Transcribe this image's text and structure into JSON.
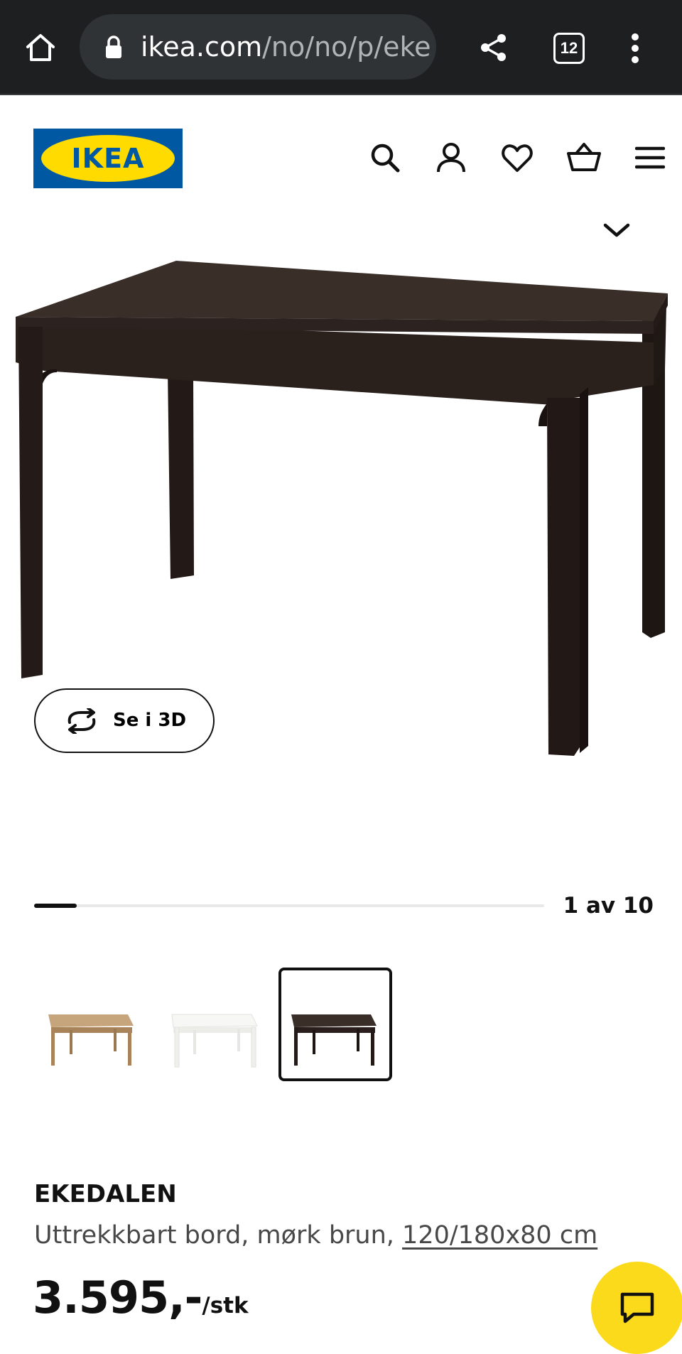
{
  "browser": {
    "url_host": "ikea.com",
    "url_path": "/no/no/p/ekeda",
    "tab_count": "12",
    "icons": [
      "home-icon",
      "lock-icon",
      "share-icon",
      "tabs-icon",
      "more-vert-icon"
    ]
  },
  "header": {
    "logo_text": "IKEA",
    "icons": [
      "search-icon",
      "account-icon",
      "favorites-icon",
      "cart-icon",
      "menu-icon"
    ],
    "colors": {
      "logo_blue": "#0058a3",
      "logo_yellow": "#ffdb00"
    }
  },
  "gallery": {
    "view_3d_label": "Se i 3D",
    "counter_text": "1 av 10",
    "progress": 0.0833,
    "thumbnails": [
      {
        "variant": "natural-oak",
        "color": "#b08a5e",
        "selected": false
      },
      {
        "variant": "white",
        "color": "#f4f4f2",
        "selected": false
      },
      {
        "variant": "dark-brown",
        "color": "#2b1f1d",
        "selected": true
      }
    ]
  },
  "product": {
    "name": "EKEDALEN",
    "description": "Uttrekkbart bord, mørk brun, ",
    "dimensions": "120/180x80 cm",
    "price": "3.595,-",
    "price_unit": "/stk"
  },
  "chat": {
    "color": "#fada1a"
  }
}
